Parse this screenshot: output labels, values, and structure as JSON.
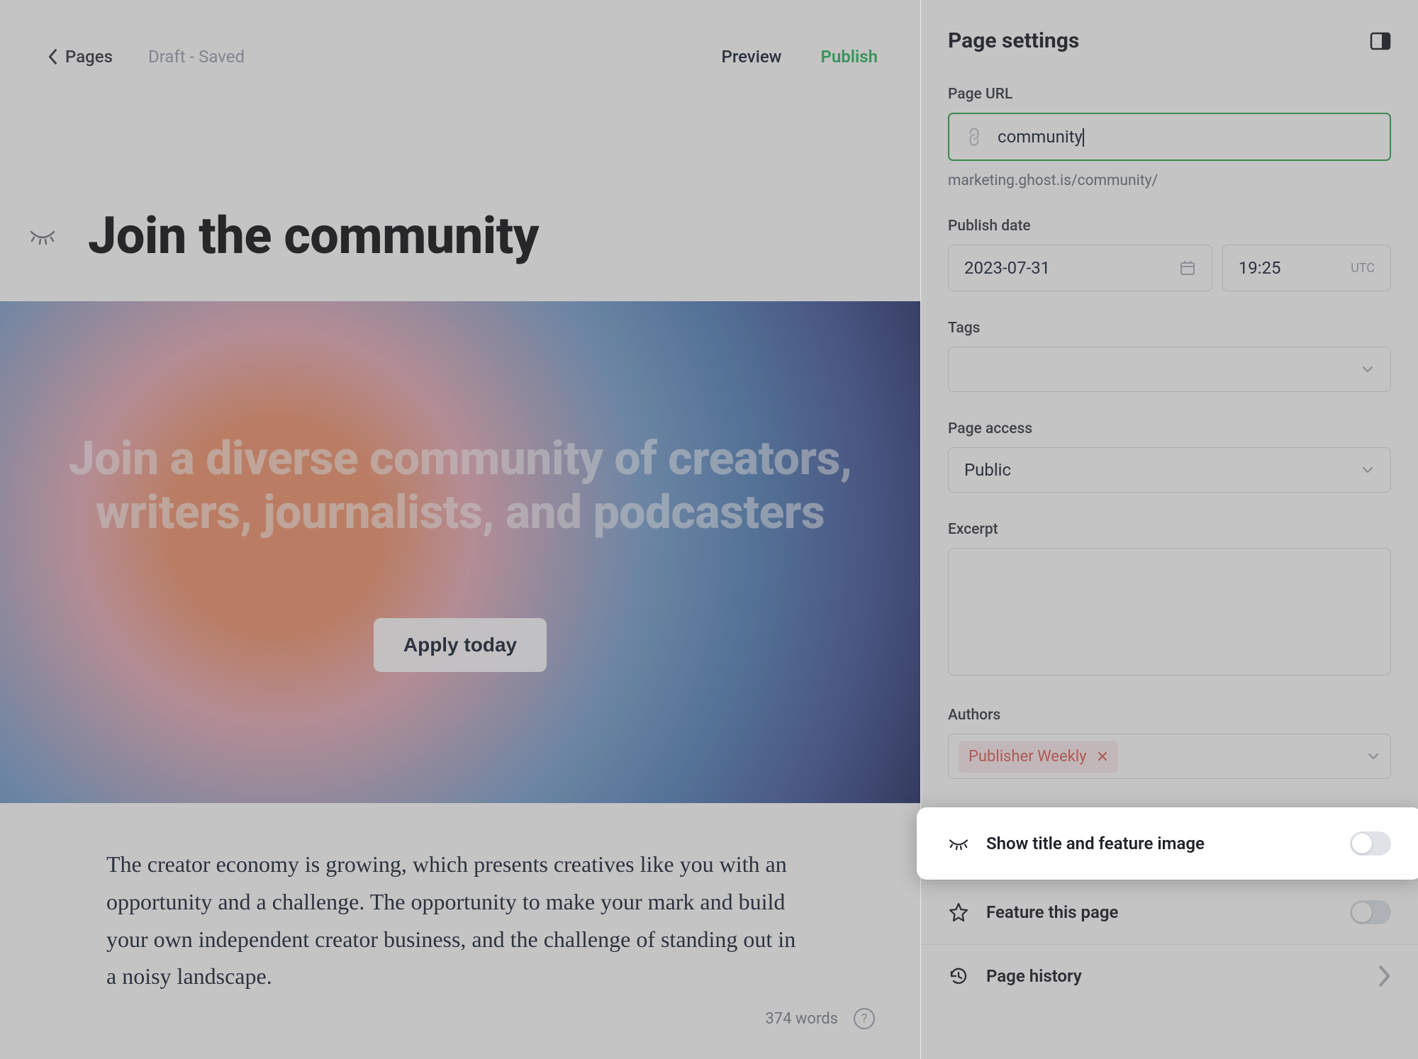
{
  "topbar": {
    "back_label": "Pages",
    "status": "Draft - Saved",
    "preview": "Preview",
    "publish": "Publish"
  },
  "editor": {
    "title": "Join the community",
    "hero_headline": "Join a diverse community of creators, writers, journalists, and podcasters",
    "hero_cta": "Apply today",
    "body": "The creator economy is growing, which presents creatives like you with an opportunity and a challenge. The opportunity to make your mark and build your own independent creator business, and the challenge of standing out in a noisy landscape.",
    "word_count": "374 words"
  },
  "sidebar": {
    "title": "Page settings",
    "page_url": {
      "label": "Page URL",
      "value": "community",
      "helper": "marketing.ghost.is/community/"
    },
    "publish_date": {
      "label": "Publish date",
      "date": "2023-07-31",
      "time": "19:25",
      "tz": "UTC"
    },
    "tags": {
      "label": "Tags"
    },
    "page_access": {
      "label": "Page access",
      "value": "Public"
    },
    "excerpt": {
      "label": "Excerpt"
    },
    "authors": {
      "label": "Authors",
      "chip": "Publisher Weekly"
    },
    "show_title": {
      "label": "Show title and feature image"
    },
    "feature_page": {
      "label": "Feature this page"
    },
    "page_history": {
      "label": "Page history"
    }
  }
}
